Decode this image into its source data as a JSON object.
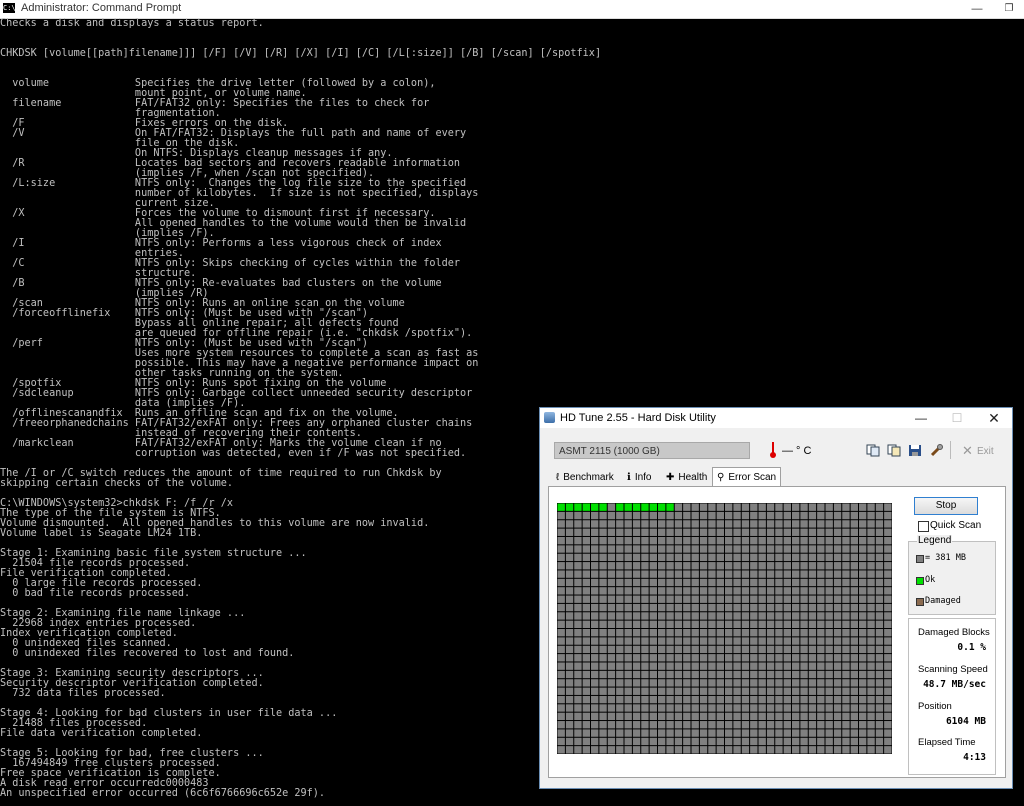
{
  "cmd": {
    "title": "Administrator: Command Prompt",
    "icon_text": "C:\\",
    "controls": {
      "minimize": "—",
      "maximize": "❐"
    },
    "lines": [
      "Checks a disk and displays a status report.",
      "",
      "",
      "CHKDSK [volume[[path]filename]]] [/F] [/V] [/R] [/X] [/I] [/C] [/L[:size]] [/B] [/scan] [/spotfix]",
      "",
      "",
      "  volume              Specifies the drive letter (followed by a colon),",
      "                      mount point, or volume name.",
      "  filename            FAT/FAT32 only: Specifies the files to check for",
      "                      fragmentation.",
      "  /F                  Fixes errors on the disk.",
      "  /V                  On FAT/FAT32: Displays the full path and name of every",
      "                      file on the disk.",
      "                      On NTFS: Displays cleanup messages if any.",
      "  /R                  Locates bad sectors and recovers readable information",
      "                      (implies /F, when /scan not specified).",
      "  /L:size             NTFS only:  Changes the log file size to the specified",
      "                      number of kilobytes.  If size is not specified, displays",
      "                      current size.",
      "  /X                  Forces the volume to dismount first if necessary.",
      "                      All opened handles to the volume would then be invalid",
      "                      (implies /F).",
      "  /I                  NTFS only: Performs a less vigorous check of index",
      "                      entries.",
      "  /C                  NTFS only: Skips checking of cycles within the folder",
      "                      structure.",
      "  /B                  NTFS only: Re-evaluates bad clusters on the volume",
      "                      (implies /R)",
      "  /scan               NTFS only: Runs an online scan on the volume",
      "  /forceofflinefix    NTFS only: (Must be used with \"/scan\")",
      "                      Bypass all online repair; all defects found",
      "                      are queued for offline repair (i.e. \"chkdsk /spotfix\").",
      "  /perf               NTFS only: (Must be used with \"/scan\")",
      "                      Uses more system resources to complete a scan as fast as",
      "                      possible. This may have a negative performance impact on",
      "                      other tasks running on the system.",
      "  /spotfix            NTFS only: Runs spot fixing on the volume",
      "  /sdcleanup          NTFS only: Garbage collect unneeded security descriptor",
      "                      data (implies /F).",
      "  /offlinescanandfix  Runs an offline scan and fix on the volume.",
      "  /freeorphanedchains FAT/FAT32/exFAT only: Frees any orphaned cluster chains",
      "                      instead of recovering their contents.",
      "  /markclean          FAT/FAT32/exFAT only: Marks the volume clean if no",
      "                      corruption was detected, even if /F was not specified.",
      "",
      "The /I or /C switch reduces the amount of time required to run Chkdsk by",
      "skipping certain checks of the volume.",
      "",
      "C:\\WINDOWS\\system32>chkdsk F: /f /r /x",
      "The type of the file system is NTFS.",
      "Volume dismounted.  All opened handles to this volume are now invalid.",
      "Volume label is Seagate LM24 1TB.",
      "",
      "Stage 1: Examining basic file system structure ...",
      "  21504 file records processed.",
      "File verification completed.",
      "  0 large file records processed.",
      "  0 bad file records processed.",
      "",
      "Stage 2: Examining file name linkage ...",
      "  22968 index entries processed.",
      "Index verification completed.",
      "  0 unindexed files scanned.",
      "  0 unindexed files recovered to lost and found.",
      "",
      "Stage 3: Examining security descriptors ...",
      "Security descriptor verification completed.",
      "  732 data files processed.",
      "",
      "Stage 4: Looking for bad clusters in user file data ...",
      "  21488 files processed.",
      "File data verification completed.",
      "",
      "Stage 5: Looking for bad, free clusters ...",
      "  167494849 free clusters processed.",
      "Free space verification is complete.",
      "A disk read error occurredc0000483",
      "An unspecified error occurred (6c6f6766696c652e 29f)."
    ]
  },
  "hdtune": {
    "title": "HD Tune 2.55 - Hard Disk Utility",
    "controls": {
      "minimize": "—",
      "maximize": "☐",
      "close": "✕"
    },
    "drive": "ASMT    2115 (1000 GB)",
    "temperature": "— ° C",
    "exit_label": "Exit",
    "tabs": {
      "benchmark": "Benchmark",
      "info": "Info",
      "health": "Health",
      "error_scan": "Error Scan"
    },
    "stop_label": "Stop",
    "quick_scan_label": "Quick Scan",
    "quick_scan_checked": false,
    "legend": {
      "title": "Legend",
      "block": "= 381 MB",
      "ok": "Ok",
      "damaged": "Damaged",
      "colors": {
        "ok": "#00e000",
        "damaged": "#8b6b50",
        "unscanned": "#808080"
      }
    },
    "stats": {
      "damaged_label": "Damaged Blocks",
      "damaged_value": "0.1 %",
      "speed_label": "Scanning Speed",
      "speed_value": "48.7 MB/sec",
      "position_label": "Position",
      "position_value": "6104 MB",
      "elapsed_label": "Elapsed Time",
      "elapsed_value": "4:13"
    },
    "grid": {
      "columns": 40,
      "rows": 30,
      "green_cells": [
        0,
        1,
        2,
        3,
        4,
        5,
        7,
        8,
        9,
        10,
        11,
        12,
        13
      ]
    }
  }
}
